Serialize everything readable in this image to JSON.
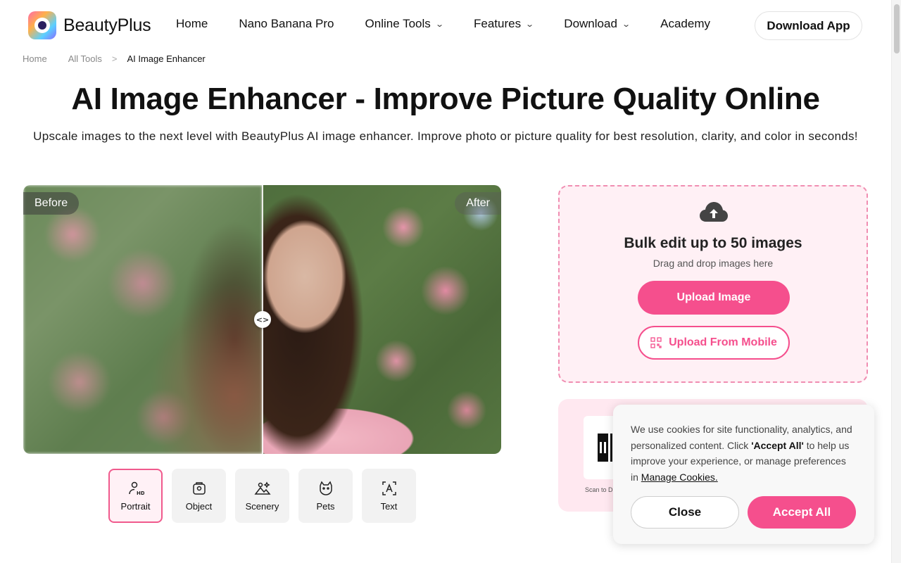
{
  "header": {
    "logo_text": "BeautyPlus",
    "nav": [
      {
        "label": "Home",
        "dropdown": false
      },
      {
        "label": "Nano Banana Pro",
        "dropdown": false
      },
      {
        "label": "Online Tools",
        "dropdown": true
      },
      {
        "label": "Features",
        "dropdown": true
      },
      {
        "label": "Download",
        "dropdown": true
      },
      {
        "label": "Academy",
        "dropdown": false
      }
    ],
    "download_app": "Download App"
  },
  "breadcrumb": {
    "home": "Home",
    "all_tools": "All Tools",
    "separator": ">",
    "current": "AI Image Enhancer"
  },
  "hero": {
    "title": "AI Image Enhancer - Improve Picture Quality Online",
    "subtitle": "Upscale images to the next level with BeautyPlus AI image enhancer. Improve photo or picture quality for best resolution, clarity, and color in seconds!"
  },
  "compare": {
    "before_label": "Before",
    "after_label": "After",
    "handle_glyph": "<>"
  },
  "categories": [
    {
      "label": "Portrait",
      "icon": "portrait-hd-icon",
      "active": true
    },
    {
      "label": "Object",
      "icon": "object-icon",
      "active": false
    },
    {
      "label": "Scenery",
      "icon": "scenery-icon",
      "active": false
    },
    {
      "label": "Pets",
      "icon": "pets-icon",
      "active": false
    },
    {
      "label": "Text",
      "icon": "text-icon",
      "active": false
    }
  ],
  "upload": {
    "title": "Bulk edit up to 50 images",
    "subtitle": "Drag and drop images here",
    "upload_button": "Upload Image",
    "mobile_button": "Upload From Mobile"
  },
  "app_panel": {
    "scan_text": "Scan to D"
  },
  "cookie": {
    "text_before": "We use cookies for site functionality, analytics, and personalized content. Click ",
    "accept_bold": "'Accept All'",
    "text_after": " to help us improve your experience, or manage preferences in ",
    "manage_link": "Manage Cookies.",
    "close_button": "Close",
    "accept_button": "Accept All"
  },
  "colors": {
    "accent": "#f54f8d",
    "upload_bg": "#fff0f5"
  }
}
